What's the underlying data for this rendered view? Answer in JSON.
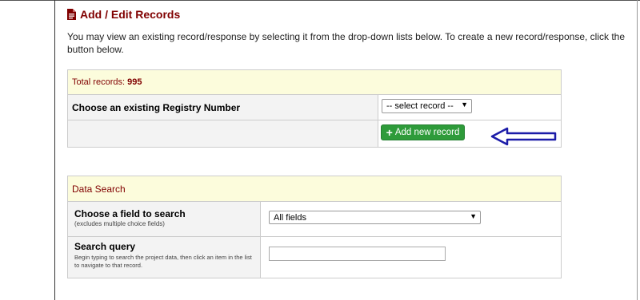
{
  "heading": {
    "title": "Add / Edit Records",
    "icon": "document-icon"
  },
  "intro": "You may view an existing record/response by selecting it from the drop-down lists below. To create a new record/response, click the button below.",
  "records": {
    "total_label": "Total records:",
    "total_value": "995",
    "choose_label": "Choose an existing Registry Number",
    "select_value": "-- select record --",
    "add_button_label": "Add new record"
  },
  "data_search": {
    "header": "Data Search",
    "field_label": "Choose a field to search",
    "field_sublabel": "(excludes multiple choice fields)",
    "field_value": "All fields",
    "query_label": "Search query",
    "query_help": "Begin typing to search the project data, then click an item in the list to navigate to that record.",
    "query_value": ""
  },
  "colors": {
    "accent": "#800000",
    "button": "#2e9b3a",
    "header_bg": "#fcfcdc",
    "arrow": "#1c1ca8"
  }
}
